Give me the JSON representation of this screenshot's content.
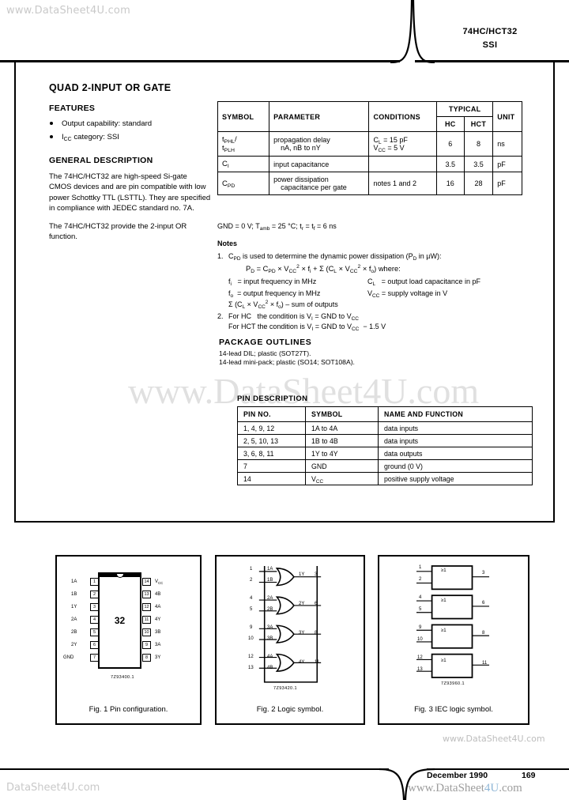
{
  "watermarks": {
    "top": "www.DataSheet4U.com",
    "middle": "www.DataSheet4U.com",
    "bottom": "DataSheet4U.com",
    "fig3_corner": "www.DataSheet4U.com",
    "footer_a": "www.DataSheet",
    "footer_b": "4U",
    "footer_c": ".com"
  },
  "header": {
    "part_number": "74HC/HCT32",
    "family": "SSI"
  },
  "left_column": {
    "title": "QUAD 2-INPUT OR GATE",
    "features_heading": "FEATURES",
    "features": [
      {
        "text": "Output capability: standard"
      },
      {
        "text_pre": "I",
        "sub": "CC",
        "text_post": " category: SSI"
      }
    ],
    "general_heading": "GENERAL DESCRIPTION",
    "paragraph_1": "The 74HC/HCT32 are high-speed Si-gate CMOS devices and are pin compatible with low power Schottky TTL (LSTTL). They are specified in compliance with JEDEC standard no. 7A.",
    "paragraph_2": "The 74HC/HCT32 provide the 2-input OR function."
  },
  "param_table": {
    "headers": {
      "symbol": "SYMBOL",
      "parameter": "PARAMETER",
      "conditions": "CONDITIONS",
      "typical": "TYPICAL",
      "hc": "HC",
      "hct": "HCT",
      "unit": "UNIT"
    },
    "rows": [
      {
        "symbol_line1_pre": "t",
        "symbol_line1_sub": "PHL",
        "symbol_line1_post": "/",
        "symbol_line2_pre": "t",
        "symbol_line2_sub": "PLH",
        "symbol_line2_post": "",
        "parameter_line1": "propagation delay",
        "parameter_line2": "nA, nB to nY",
        "cond_line1_pre": "C",
        "cond_line1_sub": "L",
        "cond_line1_post": " = 15 pF",
        "cond_line2_pre": "V",
        "cond_line2_sub": "CC",
        "cond_line2_post": " = 5 V",
        "hc": "6",
        "hct": "8",
        "unit": "ns"
      },
      {
        "symbol_line1_pre": "C",
        "symbol_line1_sub": "I",
        "symbol_line1_post": "",
        "symbol_line2_pre": "",
        "symbol_line2_sub": "",
        "symbol_line2_post": "",
        "parameter_line1": "input capacitance",
        "parameter_line2": "",
        "cond_line1_pre": "",
        "cond_line1_sub": "",
        "cond_line1_post": "",
        "cond_line2_pre": "",
        "cond_line2_sub": "",
        "cond_line2_post": "",
        "hc": "3.5",
        "hct": "3.5",
        "unit": "pF"
      },
      {
        "symbol_line1_pre": "C",
        "symbol_line1_sub": "PD",
        "symbol_line1_post": "",
        "symbol_line2_pre": "",
        "symbol_line2_sub": "",
        "symbol_line2_post": "",
        "parameter_line1": "power dissipation",
        "parameter_line2": "capacitance per gate",
        "cond_line1_pre": "notes 1 and 2",
        "cond_line1_sub": "",
        "cond_line1_post": "",
        "cond_line2_pre": "",
        "cond_line2_sub": "",
        "cond_line2_post": "",
        "hc": "16",
        "hct": "28",
        "unit": "pF"
      }
    ]
  },
  "conditions_line": {
    "a": "GND = 0 V; T",
    "a_sub": "amb",
    "b": " = 25 ",
    "degree": "°C",
    "c": "; t",
    "c_sub": "r",
    "d": " = t",
    "d_sub": "f",
    "e": " = 6 ns"
  },
  "notes": {
    "heading": "Notes",
    "note1": {
      "number": "1.",
      "lead_pre": "C",
      "lead_sub": "PD",
      "lead_post_a": " is used to determine the dynamic power dissipation (P",
      "lead_sub2": "D",
      "lead_post_b": " in µW):",
      "equation": "P_D = C_PD × V_CC² × f_i + Σ (C_L × V_CC² × f_o) where:",
      "defs": [
        {
          "left_sym": "f",
          "left_sub": "i",
          "left_txt": "= input frequency in MHz",
          "right_sym": "C",
          "right_sub": "L",
          "right_txt": "= output load capacitance in pF"
        },
        {
          "left_sym": "f",
          "left_sub": "o",
          "left_txt": "= output frequency in MHz",
          "right_sym": "V",
          "right_sub": "CC",
          "right_txt": "= supply voltage in V"
        }
      ],
      "sum_line": "Σ (C_L × V_CC² × f_o) = sum of outputs"
    },
    "note2": {
      "number": "2.",
      "line1": "For HC   the condition is V_I = GND to V_CC",
      "line2": "For HCT the condition is V_I = GND to V_CC − 1.5 V"
    }
  },
  "package": {
    "heading": "PACKAGE OUTLINES",
    "line1": "14-lead DIL; plastic (SOT27T).",
    "line2": "14-lead mini-pack; plastic (SO14; SOT108A)."
  },
  "pin_description": {
    "heading": "PIN DESCRIPTION",
    "headers": [
      "PIN NO.",
      "SYMBOL",
      "NAME AND FUNCTION"
    ],
    "rows": [
      {
        "pin": "1, 4, 9, 12",
        "symbol": "1A to 4A",
        "name": "data inputs"
      },
      {
        "pin": "2, 5, 10, 13",
        "symbol": "1B to 4B",
        "name": "data inputs"
      },
      {
        "pin": "3, 6, 8, 11",
        "symbol": "1Y to 4Y",
        "name": "data outputs"
      },
      {
        "pin": "7",
        "symbol": "GND",
        "name": "ground (0 V)"
      },
      {
        "pin": "14",
        "symbol": "VCC",
        "name": "positive supply voltage"
      }
    ]
  },
  "figures": {
    "fig1": {
      "caption": "Fig. 1  Pin configuration.",
      "code": "7Z93400.1",
      "chip_label": "32",
      "left_pins": [
        {
          "num": "1",
          "label": "1A"
        },
        {
          "num": "2",
          "label": "1B"
        },
        {
          "num": "3",
          "label": "1Y"
        },
        {
          "num": "4",
          "label": "2A"
        },
        {
          "num": "5",
          "label": "2B"
        },
        {
          "num": "6",
          "label": "2Y"
        },
        {
          "num": "7",
          "label": "GND"
        }
      ],
      "right_pins": [
        {
          "num": "14",
          "label": "VCC"
        },
        {
          "num": "13",
          "label": "4B"
        },
        {
          "num": "12",
          "label": "4A"
        },
        {
          "num": "11",
          "label": "4Y"
        },
        {
          "num": "10",
          "label": "3B"
        },
        {
          "num": "9",
          "label": "3A"
        },
        {
          "num": "8",
          "label": "3Y"
        }
      ]
    },
    "fig2": {
      "caption": "Fig. 2  Logic symbol.",
      "code": "7Z93420.1",
      "gates": [
        {
          "in_a_num": "1",
          "in_a": "1A",
          "in_b_num": "2",
          "in_b": "1B",
          "out": "1Y",
          "out_num": "3"
        },
        {
          "in_a_num": "4",
          "in_a": "2A",
          "in_b_num": "5",
          "in_b": "2B",
          "out": "2Y",
          "out_num": "6"
        },
        {
          "in_a_num": "9",
          "in_a": "3A",
          "in_b_num": "10",
          "in_b": "3B",
          "out": "3Y",
          "out_num": "8"
        },
        {
          "in_a_num": "12",
          "in_a": "4A",
          "in_b_num": "13",
          "in_b": "4B",
          "out": "4Y",
          "out_num": "11"
        }
      ]
    },
    "fig3": {
      "caption": "Fig. 3  IEC logic symbol.",
      "code": "7Z93960.1",
      "gate_label": "≥1",
      "gates": [
        {
          "in_a_num": "1",
          "in_b_num": "2",
          "out_num": "3"
        },
        {
          "in_a_num": "4",
          "in_b_num": "5",
          "out_num": "6"
        },
        {
          "in_a_num": "9",
          "in_b_num": "10",
          "out_num": "8"
        },
        {
          "in_a_num": "12",
          "in_b_num": "13",
          "out_num": "11"
        }
      ]
    }
  },
  "footer": {
    "date": "December 1990",
    "page": "169"
  }
}
